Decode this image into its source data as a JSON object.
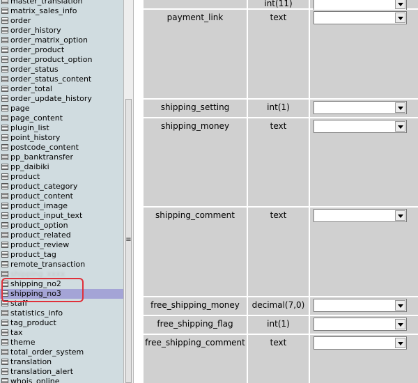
{
  "table_list": [
    {
      "label": "master_translation"
    },
    {
      "label": "matrix_sales_info"
    },
    {
      "label": "order"
    },
    {
      "label": "order_history"
    },
    {
      "label": "order_matrix_option"
    },
    {
      "label": "order_product"
    },
    {
      "label": "order_product_option"
    },
    {
      "label": "order_status"
    },
    {
      "label": "order_status_content"
    },
    {
      "label": "order_total"
    },
    {
      "label": "order_update_history"
    },
    {
      "label": "page"
    },
    {
      "label": "page_content"
    },
    {
      "label": "plugin_list"
    },
    {
      "label": "point_history"
    },
    {
      "label": "postcode_content"
    },
    {
      "label": "pp_banktransfer"
    },
    {
      "label": "pp_daibiki"
    },
    {
      "label": "product"
    },
    {
      "label": "product_category"
    },
    {
      "label": "product_content"
    },
    {
      "label": "product_image"
    },
    {
      "label": "product_input_text"
    },
    {
      "label": "product_option"
    },
    {
      "label": "product_related"
    },
    {
      "label": "product_review"
    },
    {
      "label": "product_tag"
    },
    {
      "label": "remote_transaction"
    },
    {
      "label": "shipping_xxxx"
    },
    {
      "label": "shipping_no2"
    },
    {
      "label": "shipping_no3"
    },
    {
      "label": "staff"
    },
    {
      "label": "statistics_info"
    },
    {
      "label": "tag_product"
    },
    {
      "label": "tax"
    },
    {
      "label": "theme"
    },
    {
      "label": "total_order_system"
    },
    {
      "label": "translation"
    },
    {
      "label": "translation_alert"
    },
    {
      "label": "whois_online"
    }
  ],
  "selected_table": "shipping_no3",
  "field_rows": [
    {
      "name": "",
      "type": "int(11)",
      "select_value": ""
    },
    {
      "name": "payment_link",
      "type": "text",
      "select_value": ""
    },
    {
      "name": "shipping_setting",
      "type": "int(1)",
      "select_value": ""
    },
    {
      "name": "shipping_money",
      "type": "text",
      "select_value": ""
    },
    {
      "name": "shipping_comment",
      "type": "text",
      "select_value": ""
    },
    {
      "name": "free_shipping_money",
      "type": "decimal(7,0)",
      "select_value": ""
    },
    {
      "name": "free_shipping_flag",
      "type": "int(1)",
      "select_value": ""
    },
    {
      "name": "free_shipping_comment",
      "type": "text",
      "select_value": ""
    }
  ],
  "colors": {
    "left_panel_bg": "#d0dce0",
    "selection_bg": "#a4a4d6",
    "highlight_border": "#e0303a",
    "cell_bg": "#d0d0d0"
  }
}
